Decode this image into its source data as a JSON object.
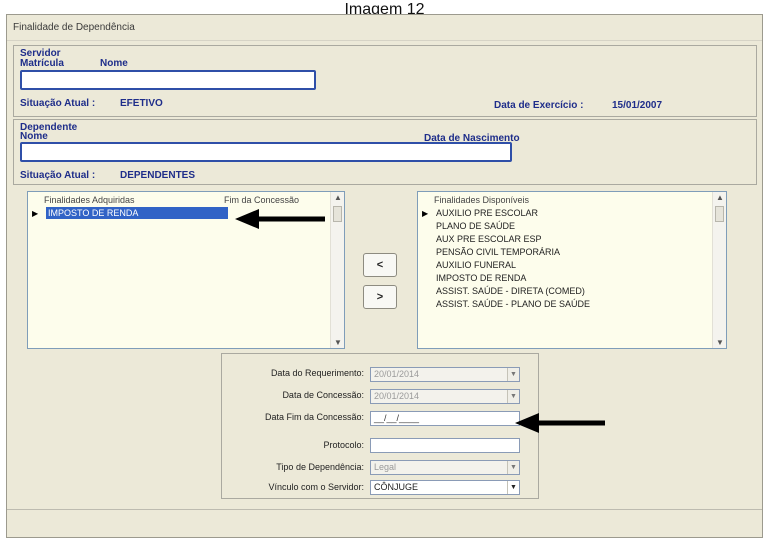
{
  "caption": "Imagem 12",
  "window": {
    "title": "Finalidade de Dependência"
  },
  "servidor": {
    "header": "Servidor",
    "matricula_label": "Matrícula",
    "nome_label": "Nome",
    "situacao_label": "Situação Atual :",
    "situacao_value": "EFETIVO",
    "data_exercicio_label": "Data de Exercício :",
    "data_exercicio_value": "15/01/2007"
  },
  "dependente": {
    "header": "Dependente",
    "nome_label": "Nome",
    "data_nascimento_label": "Data de Nascimento",
    "situacao_label": "Situação Atual :",
    "situacao_value": "DEPENDENTES"
  },
  "adquiridas": {
    "col1": "Finalidades Adquiridas",
    "col2": "Fim da Concessão",
    "items": [
      "IMPOSTO DE RENDA"
    ]
  },
  "disponiveis": {
    "col1": "Finalidades Disponíveis",
    "items": [
      "AUXILIO PRE ESCOLAR",
      "PLANO DE SAÚDE",
      "AUX PRE ESCOLAR ESP",
      "PENSÃO CIVIL TEMPORÁRIA",
      "AUXILIO FUNERAL",
      "IMPOSTO DE RENDA",
      "ASSIST. SAÚDE - DIRETA (COMED)",
      "ASSIST. SAÚDE - PLANO DE SAÚDE"
    ]
  },
  "buttons": {
    "move_left": "<",
    "move_right": ">"
  },
  "form": {
    "data_requerimento_label": "Data do Requerimento:",
    "data_requerimento_value": "20/01/2014",
    "data_concessao_label": "Data de Concessão:",
    "data_concessao_value": "20/01/2014",
    "data_fim_label": "Data Fim da Concessão:",
    "data_fim_value": "__/__/____",
    "protocolo_label": "Protocolo:",
    "protocolo_value": "",
    "tipo_label": "Tipo de Dependência:",
    "tipo_value": "Legal",
    "vinculo_label": "Vínculo com o Servidor:",
    "vinculo_value": "CÔNJUGE"
  },
  "colors": {
    "window_bg": "#ece9d8",
    "label_blue": "#1e2d8a",
    "field_border_blue": "#2f4fa8",
    "listbox_bg": "#fdfdec",
    "selection": "#3163c6"
  }
}
